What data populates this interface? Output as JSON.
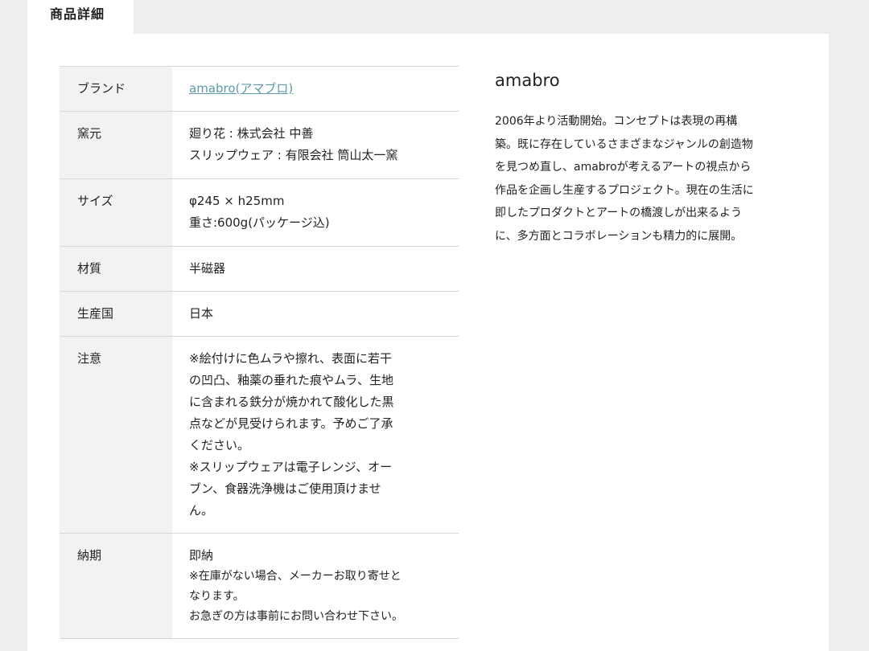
{
  "tab": {
    "label": "商品詳細"
  },
  "spec": {
    "brand": {
      "label": "ブランド",
      "value": "amabro(アマブロ)"
    },
    "kiln": {
      "label": "窯元",
      "lines": [
        "廻り花 : 株式会社 中善",
        "スリップウェア : 有限会社 筒山太一窯"
      ]
    },
    "size": {
      "label": "サイズ",
      "lines": [
        "φ245 × h25mm",
        "重さ:600g(パッケージ込)"
      ]
    },
    "material": {
      "label": "材質",
      "value": "半磁器"
    },
    "origin": {
      "label": "生産国",
      "value": "日本"
    },
    "caution": {
      "label": "注意",
      "lines": [
        "※絵付けに色ムラや擦れ、表面に若干",
        "の凹凸、釉薬の垂れた痕やムラ、生地",
        "に含まれる鉄分が焼かれて酸化した黒",
        "点などが見受けられます。予めご了承",
        "ください。",
        "※スリップウェアは電子レンジ、オー",
        "ブン、食器洗浄機はご使用頂けませ",
        "ん。"
      ]
    },
    "delivery": {
      "label": "納期",
      "main": "即納",
      "lines": [
        "※在庫がない場合、メーカーお取り寄せと",
        "なります。",
        "お急ぎの方は事前にお問い合わせ下さい。"
      ]
    }
  },
  "brand_info": {
    "title": "amabro",
    "lines": [
      "2006年より活動開始。コンセプトは表現の再構",
      "築。既に存在しているさまざまなジャンルの創造物",
      "を見つめ直し、amabroが考えるアートの視点から",
      "作品を企画し生産するプロジェクト。現在の生活に",
      "即したプロダクトとアートの橋渡しが出来るよう",
      "に、多方面とコラボレーションも精力的に展開。"
    ]
  },
  "colors": {
    "background": "#eeeeee",
    "panel": "#ffffff",
    "header_cell": "#f2f2f2",
    "link": "#5b9aa8",
    "border": "#d8d8d8"
  }
}
